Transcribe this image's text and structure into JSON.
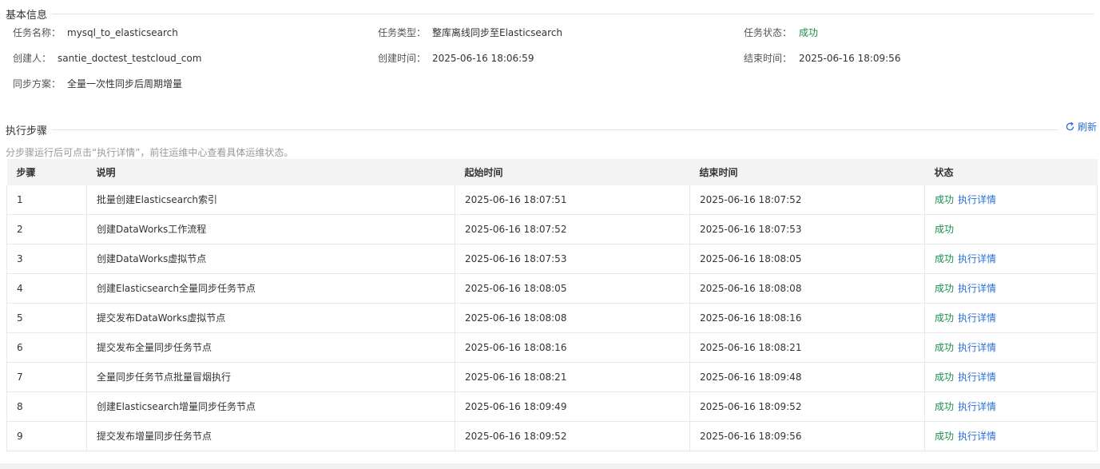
{
  "basic_info": {
    "title": "基本信息",
    "task_name_label": "任务名称：",
    "task_name": "mysql_to_elasticsearch",
    "task_type_label": "任务类型：",
    "task_type": "整库离线同步至Elasticsearch",
    "task_status_label": "任务状态：",
    "task_status": "成功",
    "creator_label": "创建人：",
    "creator": "santie_doctest_testcloud_com",
    "create_time_label": "创建时间：",
    "create_time": "2025-06-16 18:06:59",
    "end_time_label": "结束时间：",
    "end_time": "2025-06-16 18:09:56",
    "sync_plan_label": "同步方案：",
    "sync_plan": "全量一次性同步后周期增量"
  },
  "steps_section": {
    "title": "执行步骤",
    "refresh_label": "刷新",
    "hint": "分步骤运行后可点击“执行详情”，前往运维中心查看具体运维状态。",
    "colors": {
      "success": "#1a8f4d",
      "link": "#2b6fd6"
    }
  },
  "table": {
    "headers": [
      "步骤",
      "说明",
      "起始时间",
      "结束时间",
      "状态"
    ],
    "rows": [
      {
        "step": "1",
        "desc": "批量创建Elasticsearch索引",
        "start": "2025-06-16 18:07:51",
        "end": "2025-06-16 18:07:52",
        "status": "成功",
        "detail": "执行详情"
      },
      {
        "step": "2",
        "desc": "创建DataWorks工作流程",
        "start": "2025-06-16 18:07:52",
        "end": "2025-06-16 18:07:53",
        "status": "成功",
        "detail": ""
      },
      {
        "step": "3",
        "desc": "创建DataWorks虚拟节点",
        "start": "2025-06-16 18:07:53",
        "end": "2025-06-16 18:08:05",
        "status": "成功",
        "detail": "执行详情"
      },
      {
        "step": "4",
        "desc": "创建Elasticsearch全量同步任务节点",
        "start": "2025-06-16 18:08:05",
        "end": "2025-06-16 18:08:08",
        "status": "成功",
        "detail": "执行详情"
      },
      {
        "step": "5",
        "desc": "提交发布DataWorks虚拟节点",
        "start": "2025-06-16 18:08:08",
        "end": "2025-06-16 18:08:16",
        "status": "成功",
        "detail": "执行详情"
      },
      {
        "step": "6",
        "desc": "提交发布全量同步任务节点",
        "start": "2025-06-16 18:08:16",
        "end": "2025-06-16 18:08:21",
        "status": "成功",
        "detail": "执行详情"
      },
      {
        "step": "7",
        "desc": "全量同步任务节点批量冒烟执行",
        "start": "2025-06-16 18:08:21",
        "end": "2025-06-16 18:09:48",
        "status": "成功",
        "detail": "执行详情"
      },
      {
        "step": "8",
        "desc": "创建Elasticsearch增量同步任务节点",
        "start": "2025-06-16 18:09:49",
        "end": "2025-06-16 18:09:52",
        "status": "成功",
        "detail": "执行详情"
      },
      {
        "step": "9",
        "desc": "提交发布增量同步任务节点",
        "start": "2025-06-16 18:09:52",
        "end": "2025-06-16 18:09:56",
        "status": "成功",
        "detail": "执行详情"
      }
    ]
  }
}
